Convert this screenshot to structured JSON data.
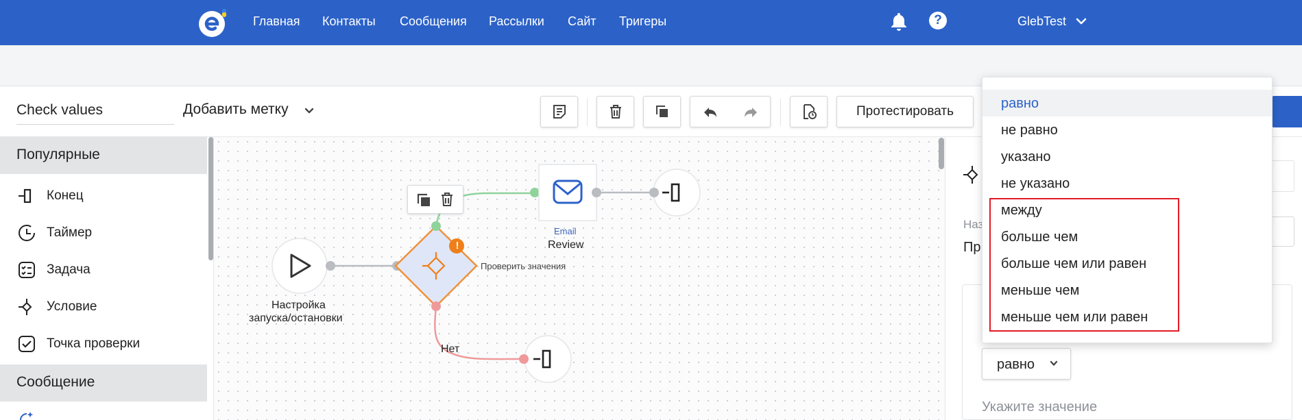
{
  "nav": {
    "items": [
      "Главная",
      "Контакты",
      "Сообщения",
      "Рассылки",
      "Сайт",
      "Тригеры"
    ],
    "user": "GlebTest",
    "help": "?"
  },
  "toolbar": {
    "title_value": "Check values",
    "add_tag": "Добавить метку",
    "test_label": "Протестировать"
  },
  "sidebar": {
    "section_popular": "Популярные",
    "items": [
      "Конец",
      "Таймер",
      "Задача",
      "Условие",
      "Точка проверки"
    ],
    "section_message": "Сообщение"
  },
  "canvas": {
    "start_label_line1": "Настройка",
    "start_label_line2": "запуска/остановки",
    "condition_label": "Проверить значения",
    "warning_badge": "!",
    "email_type": "Email",
    "email_name": "Review",
    "no_branch": "Нет"
  },
  "panel": {
    "name_label_partial": "Наз",
    "name_value_partial": "Пр",
    "operator_selected": "равно",
    "value_placeholder": "Укажите значение"
  },
  "dropdown": {
    "options": [
      "равно",
      "не равно",
      "указано",
      "не указано",
      "между",
      "больше чем",
      "больше чем или равен",
      "меньше чем",
      "меньше чем или равен"
    ],
    "selected": "равно"
  },
  "colors": {
    "brand": "#2c62c8",
    "highlight_box": "#e01b24",
    "yes_branch": "#8fd39a",
    "no_branch": "#ef9a9a",
    "condition_fill": "#dfe6f7",
    "condition_border": "#f0913a",
    "warning": "#ef7f1a"
  }
}
